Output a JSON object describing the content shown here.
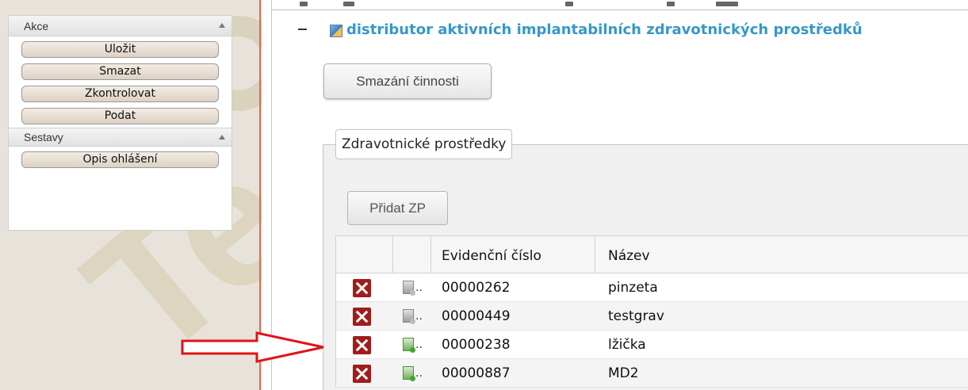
{
  "sidebar": {
    "akce": {
      "title": "Akce",
      "buttons": [
        "Uložit",
        "Smazat",
        "Zkontrolovat",
        "Podat"
      ]
    },
    "sestavy": {
      "title": "Sestavy",
      "buttons": [
        "Opis ohlášení"
      ]
    }
  },
  "tree": {
    "title": "distributor aktivních implantabilních zdravotnických prostředků"
  },
  "main": {
    "smazani_label": "Smazání činnosti",
    "fieldset_legend": "Zdravotnické prostředky",
    "pridat_label": "Přidat ZP"
  },
  "grid": {
    "columns": [
      "",
      "",
      "Evidenční číslo",
      "Název"
    ],
    "rows": [
      {
        "icon": "document-check-grey-icon",
        "evidencni_cislo": "00000262",
        "nazev": "pinzeta"
      },
      {
        "icon": "document-check-grey-icon",
        "evidencni_cislo": "00000449",
        "nazev": "testgrav"
      },
      {
        "icon": "document-add-green-icon",
        "evidencni_cislo": "00000238",
        "nazev": "lžička"
      },
      {
        "icon": "document-add-green-icon",
        "evidencni_cislo": "00000887",
        "nazev": "MD2"
      }
    ],
    "ellipsis": ".."
  },
  "colors": {
    "tree_title": "#3598c9",
    "delete_icon": "#a21c1c",
    "annotation_arrow": "#e0141a",
    "panel_divider": "#e66a4a"
  }
}
